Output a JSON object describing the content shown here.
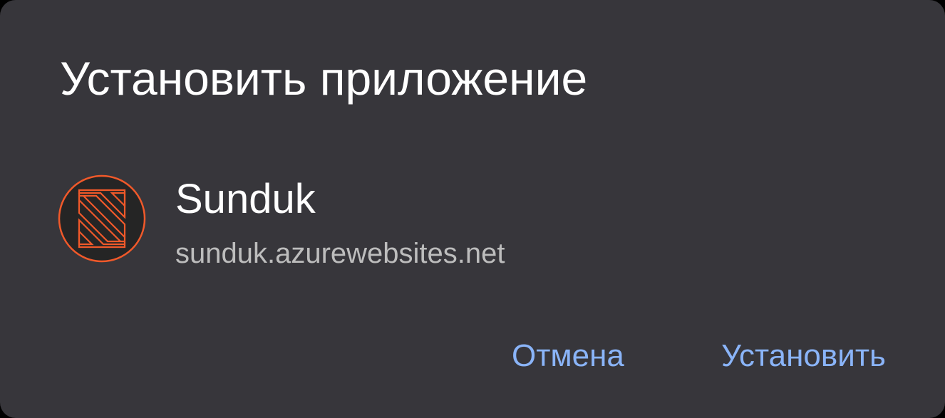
{
  "dialog": {
    "title": "Установить приложение"
  },
  "app": {
    "icon": "sunduk-logo-icon",
    "name": "Sunduk",
    "url": "sunduk.azurewebsites.net"
  },
  "actions": {
    "cancel_label": "Отмена",
    "install_label": "Установить"
  },
  "colors": {
    "dialog_background": "#37363b",
    "title_text": "#ffffff",
    "url_text": "#bdbdbd",
    "button_accent": "#8ab4f8",
    "logo_accent": "#f0592a",
    "logo_background": "#252525"
  }
}
